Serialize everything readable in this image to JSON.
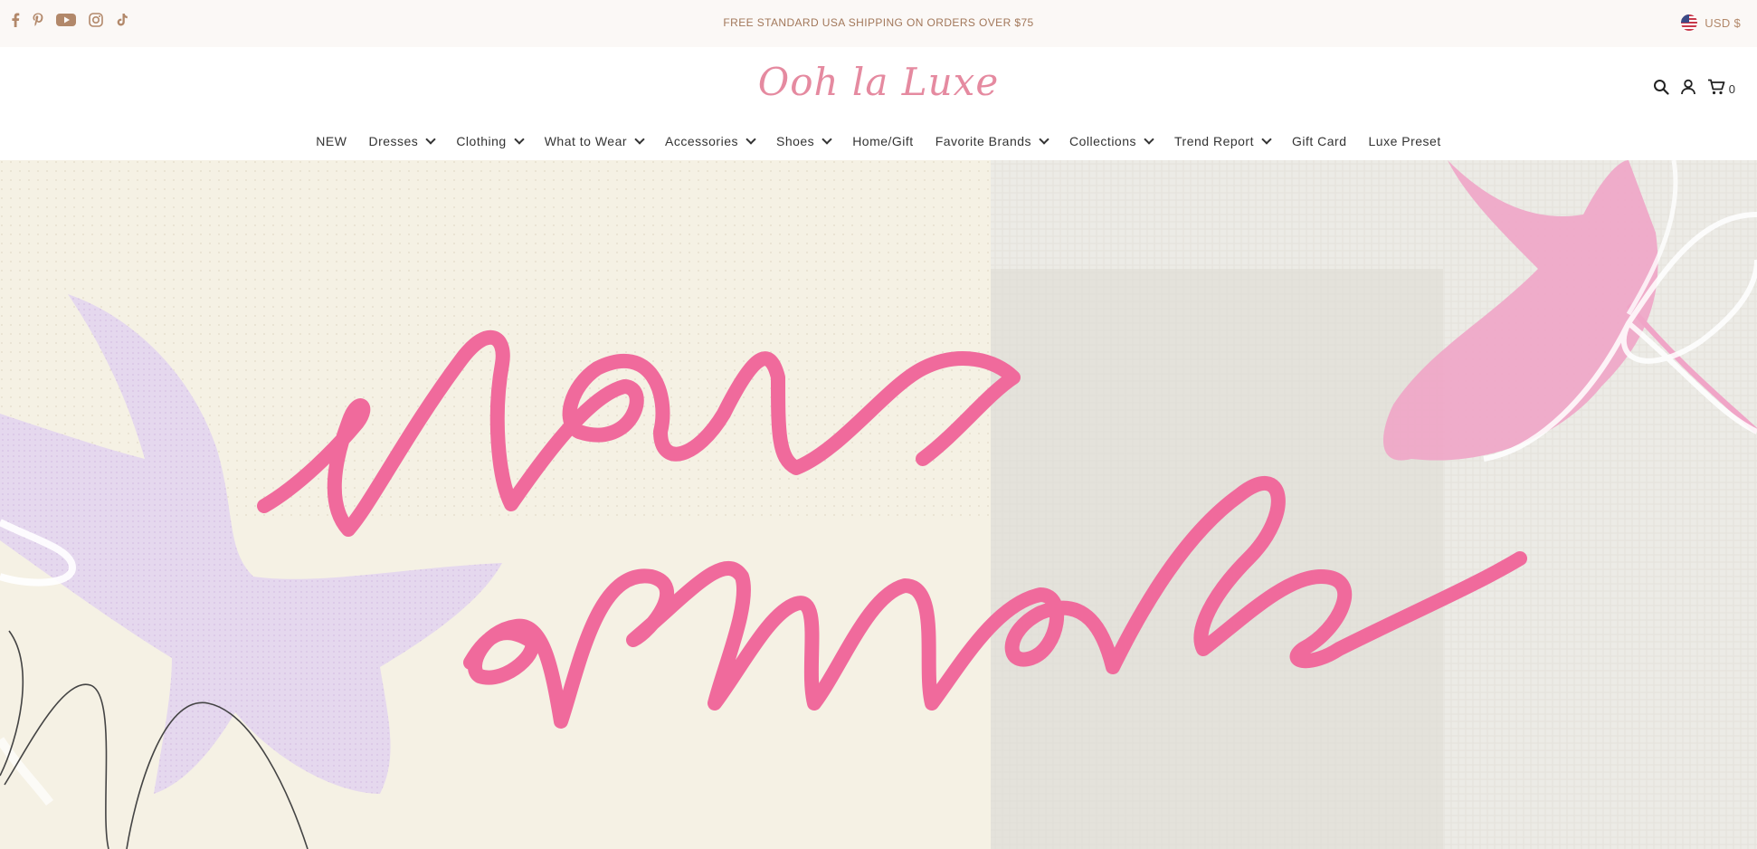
{
  "announcement": {
    "social_icons": [
      "facebook-icon",
      "pinterest-icon",
      "youtube-icon",
      "instagram-icon",
      "tiktok-icon"
    ],
    "text": "FREE STANDARD USA SHIPPING ON ORDERS OVER $75",
    "currency_label": "USD $"
  },
  "header": {
    "logo_text": "Ooh la Luxe",
    "icons": [
      "search-icon",
      "account-icon",
      "cart-icon"
    ],
    "cart_count": "0"
  },
  "nav": {
    "items": [
      {
        "label": "NEW",
        "dropdown": false
      },
      {
        "label": "Dresses",
        "dropdown": true
      },
      {
        "label": "Clothing",
        "dropdown": true
      },
      {
        "label": "What to Wear",
        "dropdown": true
      },
      {
        "label": "Accessories",
        "dropdown": true
      },
      {
        "label": "Shoes",
        "dropdown": true
      },
      {
        "label": "Home/Gift",
        "dropdown": false
      },
      {
        "label": "Favorite Brands",
        "dropdown": true
      },
      {
        "label": "Collections",
        "dropdown": true
      },
      {
        "label": "Trend Report",
        "dropdown": true
      },
      {
        "label": "Gift Card",
        "dropdown": false
      },
      {
        "label": "Luxe Preset",
        "dropdown": false
      }
    ]
  },
  "hero": {
    "title_line1": "new",
    "title_line2": "arrivals",
    "colors": {
      "script": "#f06a9c",
      "lilac": "#e5d8ee",
      "pink_leaf": "#f0a5c7",
      "paper": "#f5f1e4",
      "gray_panel": "#e7e5df"
    }
  },
  "colors": {
    "accent": "#e58aa0",
    "topbar_bg": "#fbf8f6",
    "topbar_text": "#a2775a"
  }
}
